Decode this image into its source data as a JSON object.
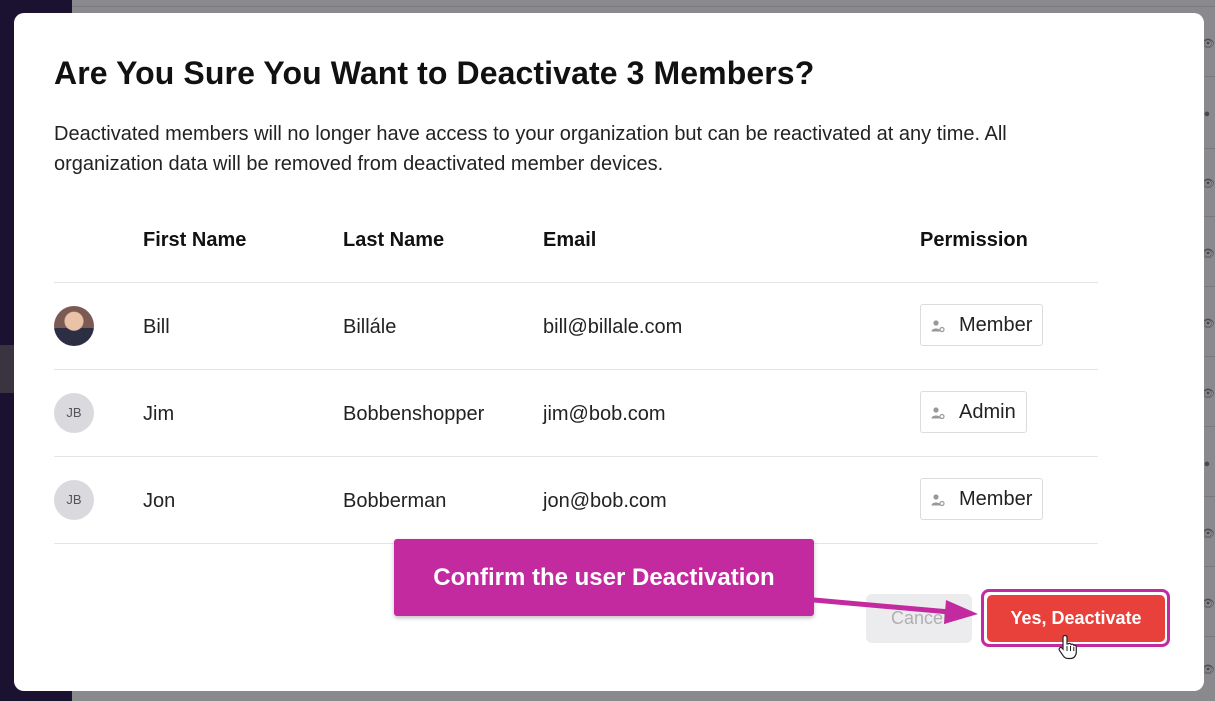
{
  "modal": {
    "title": "Are You Sure You Want to Deactivate 3 Members?",
    "description": "Deactivated members will no longer have access to your organization but can be reactivated at any time. All organization data will be removed from deactivated member devices.",
    "columns": {
      "first_name": "First Name",
      "last_name": "Last Name",
      "email": "Email",
      "permission": "Permission"
    },
    "members": [
      {
        "initials": "",
        "avatar": "photo",
        "first_name": "Bill",
        "last_name": "Billále",
        "email": "bill@billale.com",
        "permission": "Member"
      },
      {
        "initials": "JB",
        "avatar": "initials",
        "first_name": "Jim",
        "last_name": "Bobbenshopper",
        "email": "jim@bob.com",
        "permission": "Admin"
      },
      {
        "initials": "JB",
        "avatar": "initials",
        "first_name": "Jon",
        "last_name": "Bobberman",
        "email": "jon@bob.com",
        "permission": "Member"
      }
    ],
    "cancel_label": "Cancel",
    "confirm_label": "Yes, Deactivate"
  },
  "annotation": {
    "callout_text": "Confirm the user Deactivation"
  },
  "colors": {
    "accent": "#c42aa0",
    "danger": "#e8403a"
  },
  "icons": {
    "permission": "user-settings-icon",
    "background_row": "eye-icon",
    "cursor": "hand-pointer-icon"
  }
}
